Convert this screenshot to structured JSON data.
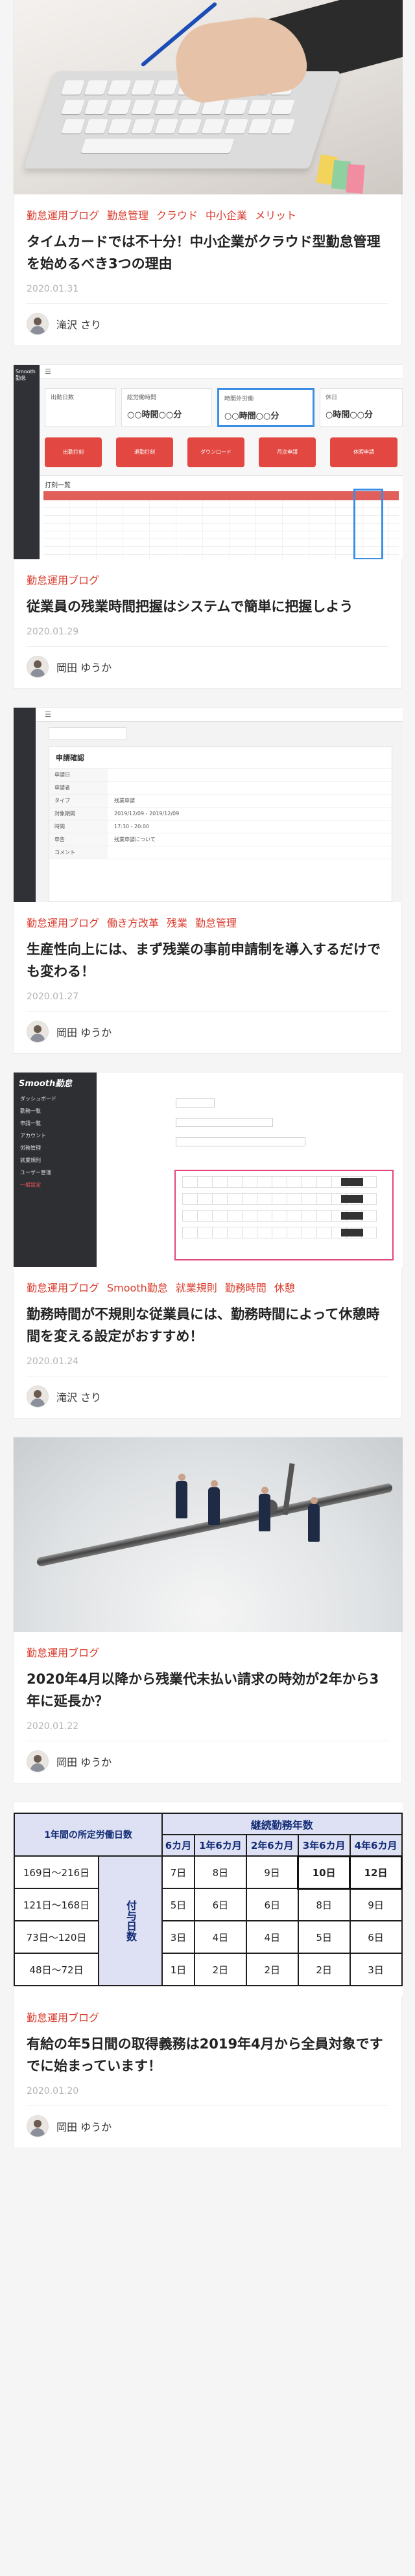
{
  "articles": [
    {
      "tags": [
        "勤怠運用ブログ",
        "勤怠管理",
        "クラウド",
        "中小企業",
        "メリット"
      ],
      "title": "タイムカードでは不十分！中小企業がクラウド型勤怠管理を始めるべき3つの理由",
      "date": "2020.01.31",
      "author": "滝沢 さり"
    },
    {
      "tags": [
        "勤怠運用ブログ"
      ],
      "title": "従業員の残業時間把握はシステムで簡単に把握しよう",
      "date": "2020.01.29",
      "author": "岡田 ゆうか",
      "screenshot": {
        "logo": "Smooth 勤怠",
        "stats": [
          "出勤日数",
          "総労働時間",
          "時間外労働",
          "休日"
        ],
        "stat_values": [
          "",
          "○○時間○○分",
          "○○時間○○分",
          "○時間○○分"
        ],
        "buttons": [
          "出勤打刻",
          "退勤打刻",
          "ダウンロード",
          "月次申請",
          "休暇申請"
        ],
        "table_title": "打刻一覧"
      }
    },
    {
      "tags": [
        "勤怠運用ブログ",
        "働き方改革",
        "残業",
        "勤怠管理"
      ],
      "title": "生産性向上には、まず残業の事前申請制を導入するだけでも変わる！",
      "date": "2020.01.27",
      "author": "岡田 ゆうか",
      "screenshot": {
        "panel_title": "申請確認",
        "rows": [
          {
            "k": "申請日",
            "v": ""
          },
          {
            "k": "申請者",
            "v": ""
          },
          {
            "k": "タイプ",
            "v": "残業申請"
          },
          {
            "k": "対象期間",
            "v": "2019/12/09 - 2019/12/09"
          },
          {
            "k": "時間",
            "v": "17:30 - 20:00"
          },
          {
            "k": "申告",
            "v": "残業申請について"
          },
          {
            "k": "コメント",
            "v": ""
          }
        ]
      }
    },
    {
      "tags": [
        "勤怠運用ブログ",
        "Smooth勤怠",
        "就業規則",
        "勤務時間",
        "休憩"
      ],
      "title": "勤務時間が不規則な従業員には、勤務時間によって休憩時間を変える設定がおすすめ！",
      "date": "2020.01.24",
      "author": "滝沢 さり",
      "screenshot": {
        "logo": "Smooth勤怠",
        "menu": [
          "ダッシュボード",
          "勤務一覧",
          "申請一覧",
          "アカウント",
          "労務管理",
          "就業規則",
          "ユーザー管理",
          "一般設定"
        ]
      }
    },
    {
      "tags": [
        "勤怠運用ブログ"
      ],
      "title": "2020年4月以降から残業代未払い請求の時効が2年から3年に延長か？",
      "date": "2020.01.22",
      "author": "岡田 ゆうか"
    },
    {
      "tags": [
        "勤怠運用ブログ"
      ],
      "title": "有給の年5日間の取得義務は2019年4月から全員対象ですでに始まっています！",
      "date": "2020.01.20",
      "author": "岡田 ゆうか",
      "table": {
        "corner": "1年間の所定労働日数",
        "group_header": "継続勤務年数",
        "side_label": "付与日数",
        "columns": [
          "6カ月",
          "1年6カ月",
          "2年6カ月",
          "3年6カ月",
          "4年6カ月"
        ],
        "rows": [
          {
            "label": "169日〜216日",
            "cells": [
              "7日",
              "8日",
              "9日",
              "10日",
              "12日"
            ]
          },
          {
            "label": "121日〜168日",
            "cells": [
              "5日",
              "6日",
              "6日",
              "8日",
              "9日"
            ]
          },
          {
            "label": "73日〜120日",
            "cells": [
              "3日",
              "4日",
              "4日",
              "5日",
              "6日"
            ]
          },
          {
            "label": "48日〜72日",
            "cells": [
              "1日",
              "2日",
              "2日",
              "2日",
              "3日"
            ]
          }
        ]
      }
    }
  ],
  "colors": {
    "tag": "#d93a2b",
    "date": "#b4b4b4",
    "accent": "#e24841"
  }
}
